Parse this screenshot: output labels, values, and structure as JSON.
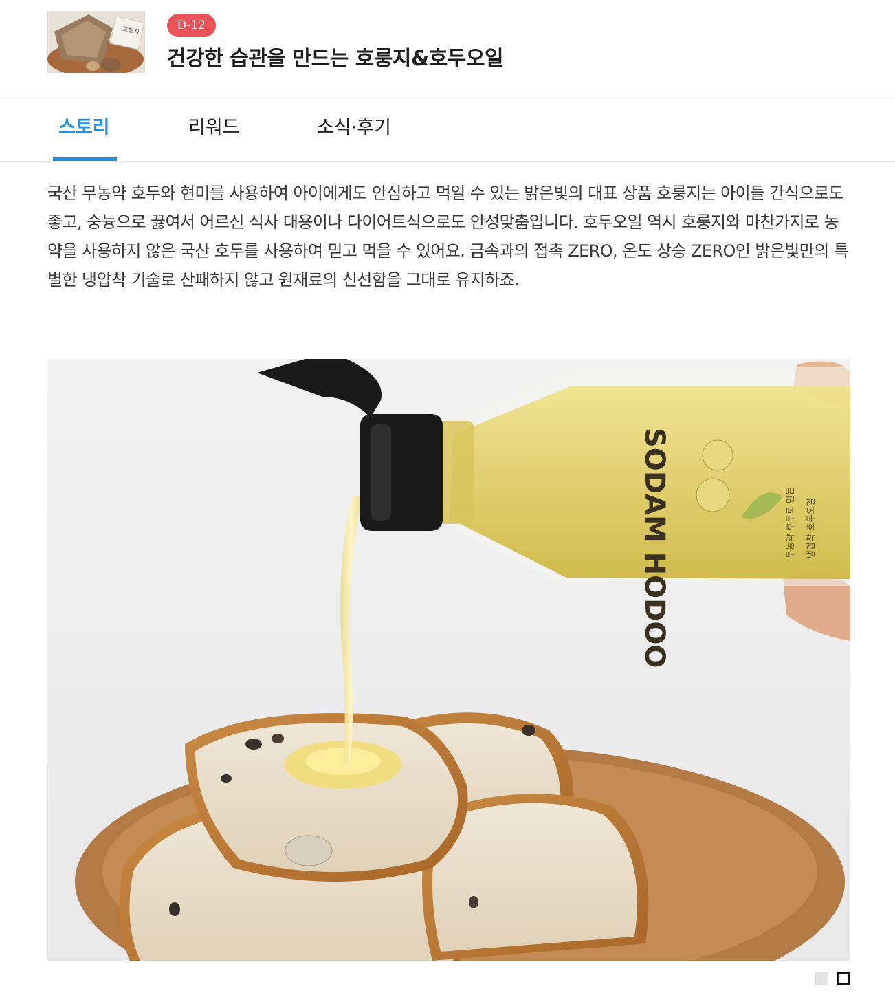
{
  "header": {
    "thumbnail_alt": "호룡지 product",
    "badge": "D-12",
    "title": "건강한 습관을 만드는 호룽지&호두오일"
  },
  "tabs": [
    {
      "label": "스토리",
      "active": true
    },
    {
      "label": "리워드",
      "active": false
    },
    {
      "label": "소식·후기",
      "active": false
    }
  ],
  "story": {
    "text": "국산 무농약 호두와 현미를 사용하여 아이에게도 안심하고 먹일 수 있는 밝은빛의 대표 상품 호룽지는 아이들 간식으로도 좋고, 숭늉으로 끓여서 어르신 식사 대용이나 다이어트식으로도 안성맞춤입니다. 호두오일 역시 호룽지와 마찬가지로 농약을 사용하지 않은 국산 호두를 사용하여 믿고 먹을 수 있어요. 금속과의 접촉 ZERO, 온도 상승 ZERO인 밝은빛만의 특별한 냉압착 기술로 산패하지 않고 원재료의 신선함을 그대로 유지하죠."
  },
  "photo": {
    "bottle_label": "SODAM HODOO",
    "bottle_sub1": "무농약 호두로 만든",
    "bottle_sub2": "냉압착 호두오일"
  },
  "pager": {
    "count": 2,
    "active_index": 1
  },
  "colors": {
    "accent": "#1e90e6",
    "badge": "#e8545a"
  }
}
